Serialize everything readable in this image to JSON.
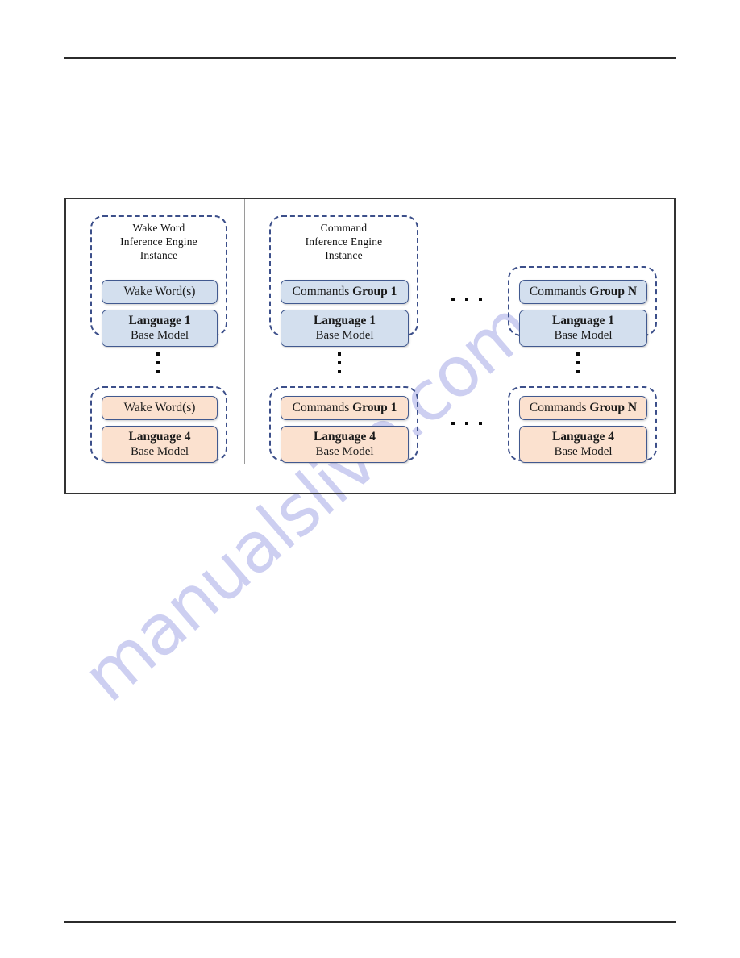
{
  "page": {
    "watermark_text": "manualslive.com",
    "watermark_color": "#c9cbf0",
    "rule_color": "#2b2b2b",
    "frame_border_color": "#333333"
  },
  "figure": {
    "separator_color": "#9a9a9a",
    "group_border_color": "#3c4f8a",
    "box_border_color": "#41598f",
    "fill_top_row": "#d3dfee",
    "fill_bottom_row": "#fbe1cf",
    "columns": [
      {
        "id": "wake-word",
        "header": {
          "line1": "Wake Word",
          "line2": "Inference  Engine",
          "line3": "Instance"
        },
        "top": {
          "title_box": {
            "text": "Wake Word(s)"
          },
          "model_box": {
            "line1": "Language 1",
            "line2": "Base Model"
          }
        },
        "bottom": {
          "title_box": {
            "text": "Wake Word(s)"
          },
          "model_box": {
            "line1": "Language 4",
            "line2": "Base Model"
          }
        }
      },
      {
        "id": "command-group-1",
        "header": {
          "line1": "Command",
          "line2": "Inference  Engine",
          "line3": "Instance"
        },
        "top": {
          "title_box": {
            "prefix": "Commands ",
            "emphasis": "Group 1"
          },
          "model_box": {
            "line1": "Language 1",
            "line2": "Base Model"
          }
        },
        "bottom": {
          "title_box": {
            "prefix": "Commands ",
            "emphasis": "Group 1"
          },
          "model_box": {
            "line1": "Language 4",
            "line2": "Base Model"
          }
        }
      },
      {
        "id": "command-group-n",
        "header": null,
        "top": {
          "title_box": {
            "prefix": "Commands ",
            "emphasis": "Group N"
          },
          "model_box": {
            "line1": "Language 1",
            "line2": "Base Model"
          }
        },
        "bottom": {
          "title_box": {
            "prefix": "Commands ",
            "emphasis": "Group N"
          },
          "model_box": {
            "line1": "Language 4",
            "line2": "Base Model"
          }
        }
      }
    ],
    "ellipsis": {
      "vertical_dot_count": 3,
      "horizontal_dot_count": 3
    }
  }
}
